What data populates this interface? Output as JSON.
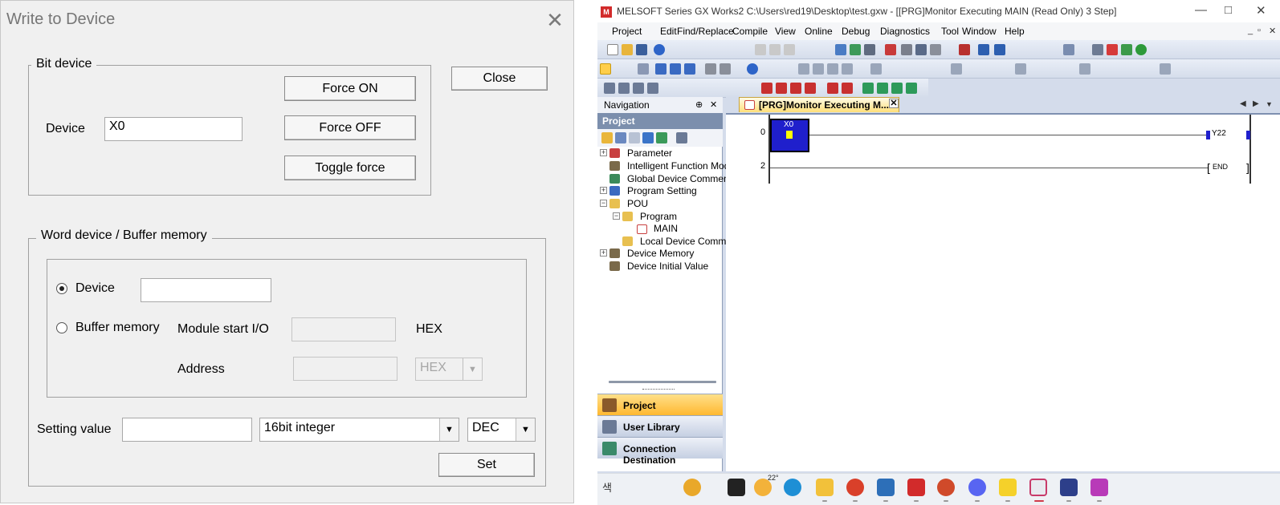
{
  "dialog": {
    "title": "Write to Device",
    "close_x": "✕",
    "bit_group": {
      "label": "Bit device",
      "device_label": "Device",
      "device_value": "X0",
      "force_on": "Force ON",
      "force_off": "Force OFF",
      "toggle_force": "Toggle force"
    },
    "close_button": "Close",
    "word_group": {
      "label": "Word device / Buffer memory",
      "device_radio": "Device",
      "device_value": "",
      "buffer_radio": "Buffer memory",
      "module_start_label": "Module start I/O",
      "module_start_value": "",
      "hex_label": "HEX",
      "address_label": "Address",
      "address_value": "",
      "address_format": "HEX"
    },
    "setting": {
      "label": "Setting value",
      "value": "",
      "data_type": "16bit integer",
      "radix": "DEC",
      "set_button": "Set"
    }
  },
  "gx": {
    "window_title": "MELSOFT Series GX Works2 C:\\Users\\red19\\Desktop\\test.gxw - [[PRG]Monitor Executing MAIN (Read Only) 3 Step]",
    "menu": [
      "Project",
      "Edit",
      "Find/Replace",
      "Compile",
      "View",
      "Online",
      "Debug",
      "Diagnostics",
      "Tool",
      "Window",
      "Help"
    ],
    "navigation": {
      "title": "Navigation",
      "section": "Project",
      "tree": [
        "Parameter",
        "Intelligent Function Modu",
        "Global Device Comment",
        "Program Setting",
        "POU",
        "Program",
        "MAIN",
        "Local Device Commer",
        "Device Memory",
        "Device Initial Value"
      ],
      "buttons": [
        "Project",
        "User Library",
        "Connection Destination"
      ]
    },
    "tab_title": "[PRG]Monitor Executing M...",
    "ladder": {
      "rung0_step": "0",
      "rung0_contact": "X0",
      "rung0_coil": "Y22",
      "rung1_step": "2",
      "rung1_end": "END"
    },
    "taskbar": {
      "search_text": "색",
      "weather_temp": "22°"
    }
  }
}
